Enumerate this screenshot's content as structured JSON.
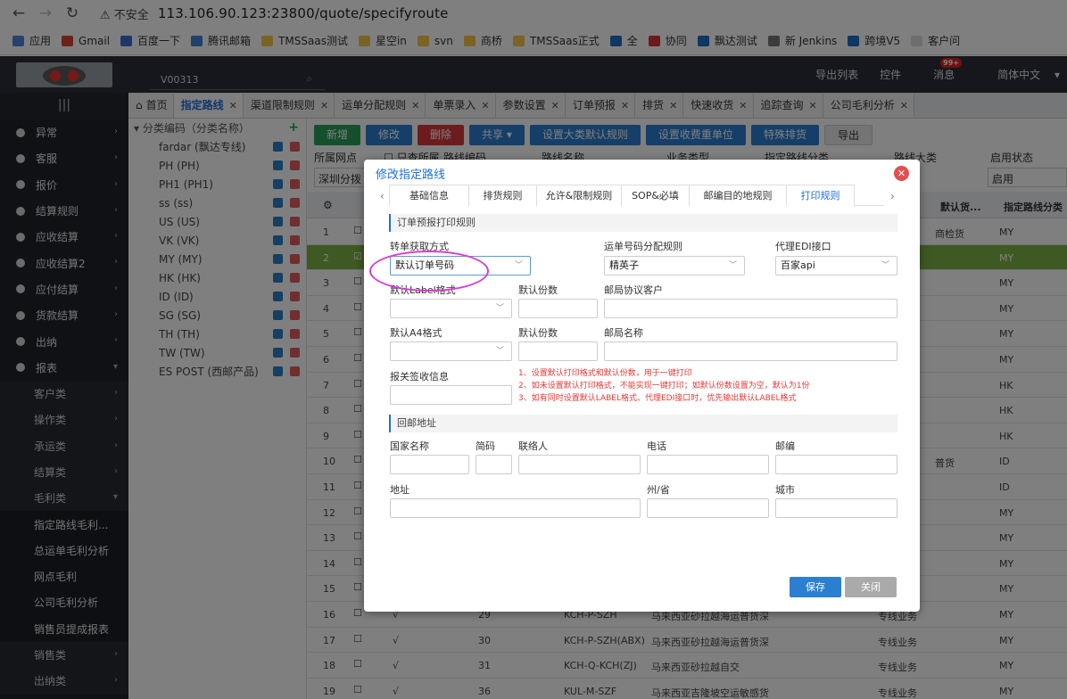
{
  "browser": {
    "security": "不安全",
    "url": "113.106.90.123:23800/quote/specifyroute",
    "bookmarks": [
      "应用",
      "Gmail",
      "百度一下",
      "腾讯邮箱",
      "TMSSaas测试",
      "星空in",
      "svn",
      "商桥",
      "TMSSaas正式",
      "全",
      "协同",
      "飘达测试",
      "新 Jenkins",
      "跨境V5",
      "客户问"
    ]
  },
  "header": {
    "search_value": "V00313",
    "links": [
      "导出列表",
      "控件",
      "消息",
      "简体中文"
    ],
    "msg_badge": "99+"
  },
  "sidebar": {
    "items": [
      {
        "label": "异常",
        "type": "main"
      },
      {
        "label": "客服",
        "type": "main"
      },
      {
        "label": "报价",
        "type": "main"
      },
      {
        "label": "结算规则",
        "type": "main"
      },
      {
        "label": "应收结算",
        "type": "main"
      },
      {
        "label": "应收结算2",
        "type": "main"
      },
      {
        "label": "应付结算",
        "type": "main"
      },
      {
        "label": "货款结算",
        "type": "main"
      },
      {
        "label": "出纳",
        "type": "main"
      },
      {
        "label": "报表",
        "type": "main"
      },
      {
        "label": "客户类",
        "type": "sub"
      },
      {
        "label": "操作类",
        "type": "sub"
      },
      {
        "label": "承运类",
        "type": "sub"
      },
      {
        "label": "结算类",
        "type": "sub"
      },
      {
        "label": "毛利类",
        "type": "sub"
      },
      {
        "label": "指定路线毛利...",
        "type": "sub2"
      },
      {
        "label": "总运单毛利分析",
        "type": "sub2"
      },
      {
        "label": "网点毛利",
        "type": "sub2"
      },
      {
        "label": "公司毛利分析",
        "type": "sub2"
      },
      {
        "label": "销售员提成报表",
        "type": "sub2"
      },
      {
        "label": "销售类",
        "type": "sub"
      },
      {
        "label": "出纳类",
        "type": "sub"
      }
    ]
  },
  "tabs": [
    {
      "label": "首页"
    },
    {
      "label": "指定路线"
    },
    {
      "label": "渠道限制规则"
    },
    {
      "label": "运单分配规则"
    },
    {
      "label": "单票录入"
    },
    {
      "label": "参数设置"
    },
    {
      "label": "订单预报"
    },
    {
      "label": "排货"
    },
    {
      "label": "快速收货"
    },
    {
      "label": "追踪查询"
    },
    {
      "label": "公司毛利分析"
    }
  ],
  "tree": {
    "header": "分类编码（分类名称）",
    "items": [
      "fardar (飘达专线)",
      "PH (PH)",
      "PH1 (PH1)",
      "ss (ss)",
      "US (US)",
      "VK (VK)",
      "MY (MY)",
      "HK (HK)",
      "ID (ID)",
      "SG (SG)",
      "TH (TH)",
      "TW (TW)",
      "ES POST (西邮产品)"
    ]
  },
  "toolbar": [
    "新增",
    "修改",
    "删除",
    "共享",
    "设置大类默认规则",
    "设置收费重单位",
    "特殊排货",
    "导出"
  ],
  "filters": {
    "labels": [
      "所属网点",
      "只查所属",
      "路线编码",
      "路线名称",
      "业务类型",
      "指定路线分类",
      "路线大类",
      "启用状态"
    ],
    "network_value": "深圳分拨",
    "status_value": "启用"
  },
  "grid": {
    "headers": [
      "默认货...",
      "指定路线分类"
    ],
    "rows": [
      {
        "n": "1",
        "a": "",
        "b": "",
        "c": "",
        "d": "",
        "e": "",
        "f": "商检货",
        "g": "MY"
      },
      {
        "n": "2",
        "a": "",
        "b": "",
        "c": "",
        "d": "",
        "e": "",
        "f": "",
        "g": "MY"
      },
      {
        "n": "3",
        "a": "",
        "b": "",
        "c": "",
        "d": "",
        "e": "",
        "f": "",
        "g": "MY"
      },
      {
        "n": "4",
        "a": "",
        "b": "",
        "c": "",
        "d": "",
        "e": "",
        "f": "",
        "g": "MY"
      },
      {
        "n": "5",
        "a": "",
        "b": "",
        "c": "",
        "d": "",
        "e": "",
        "f": "",
        "g": "MY"
      },
      {
        "n": "6",
        "a": "",
        "b": "",
        "c": "",
        "d": "",
        "e": "",
        "f": "",
        "g": "MY"
      },
      {
        "n": "7",
        "a": "",
        "b": "",
        "c": "",
        "d": "",
        "e": "",
        "f": "",
        "g": "HK"
      },
      {
        "n": "8",
        "a": "",
        "b": "",
        "c": "",
        "d": "",
        "e": "",
        "f": "",
        "g": "HK"
      },
      {
        "n": "9",
        "a": "",
        "b": "",
        "c": "",
        "d": "",
        "e": "",
        "f": "",
        "g": "HK"
      },
      {
        "n": "10",
        "a": "",
        "b": "",
        "c": "",
        "d": "",
        "e": "",
        "f": "普货",
        "g": "ID"
      },
      {
        "n": "11",
        "a": "",
        "b": "",
        "c": "",
        "d": "",
        "e": "",
        "f": "",
        "g": "ID"
      },
      {
        "n": "12",
        "a": "",
        "b": "",
        "c": "",
        "d": "",
        "e": "",
        "f": "",
        "g": "MY"
      },
      {
        "n": "13",
        "a": "",
        "b": "",
        "c": "",
        "d": "",
        "e": "",
        "f": "",
        "g": "MY"
      },
      {
        "n": "14",
        "a": "",
        "b": "",
        "c": "",
        "d": "",
        "e": "",
        "f": "",
        "g": "MY"
      },
      {
        "n": "15",
        "a": "",
        "b": "",
        "c": "",
        "d": "",
        "e": "",
        "f": "",
        "g": "MY"
      },
      {
        "n": "16",
        "a": "√",
        "b": "29",
        "c": "KCH-P-SZH",
        "d": "马来西亚砂拉越海运普货深",
        "e": "专线业务",
        "f": "",
        "g": "MY"
      },
      {
        "n": "17",
        "a": "√",
        "b": "30",
        "c": "KCH-P-SZH(ABX)",
        "d": "马来西亚砂拉越海运普货深",
        "e": "专线业务",
        "f": "",
        "g": "MY"
      },
      {
        "n": "18",
        "a": "√",
        "b": "31",
        "c": "KCH-Q-KCH(ZJ)",
        "d": "马来西亚砂拉越自交",
        "e": "专线业务",
        "f": "",
        "g": "MY"
      },
      {
        "n": "19",
        "a": "√",
        "b": "36",
        "c": "KUL-M-SZF",
        "d": "马来西亚吉隆坡空运敏感货",
        "e": "专线业务",
        "f": "",
        "g": "MY"
      }
    ]
  },
  "modal": {
    "title": "修改指定路线",
    "tabs": [
      "基础信息",
      "排货规则",
      "允许&限制规则",
      "SOP&必填",
      "邮编目的地规则",
      "打印规则"
    ],
    "section1": "订单预报打印规则",
    "section2": "回邮地址",
    "labels": {
      "convert": "转单获取方式",
      "waybill": "运单号码分配规则",
      "edi": "代理EDI接口",
      "label_fmt": "默认Label格式",
      "copies1": "默认份数",
      "post_client": "邮局协议客户",
      "a4_fmt": "默认A4格式",
      "copies2": "默认份数",
      "post_name": "邮局名称",
      "customs": "报关签收信息",
      "country": "国家名称",
      "code": "简码",
      "contact": "联络人",
      "phone": "电话",
      "zip": "邮编",
      "address": "地址",
      "state": "州/省",
      "city": "城市"
    },
    "values": {
      "convert": "默认订单号码",
      "waybill": "精英子",
      "edi": "百家api"
    },
    "notes": [
      "1、设置默认打印格式和默认份数，用于一键打印",
      "2、如未设置默认打印格式，不能实现一键打印；如默认份数设置为空，默认为1份",
      "3、如有同时设置默认LABEL格式、代理EDI接口时，优先输出默认LABEL格式"
    ],
    "save": "保存",
    "close": "关闭"
  }
}
